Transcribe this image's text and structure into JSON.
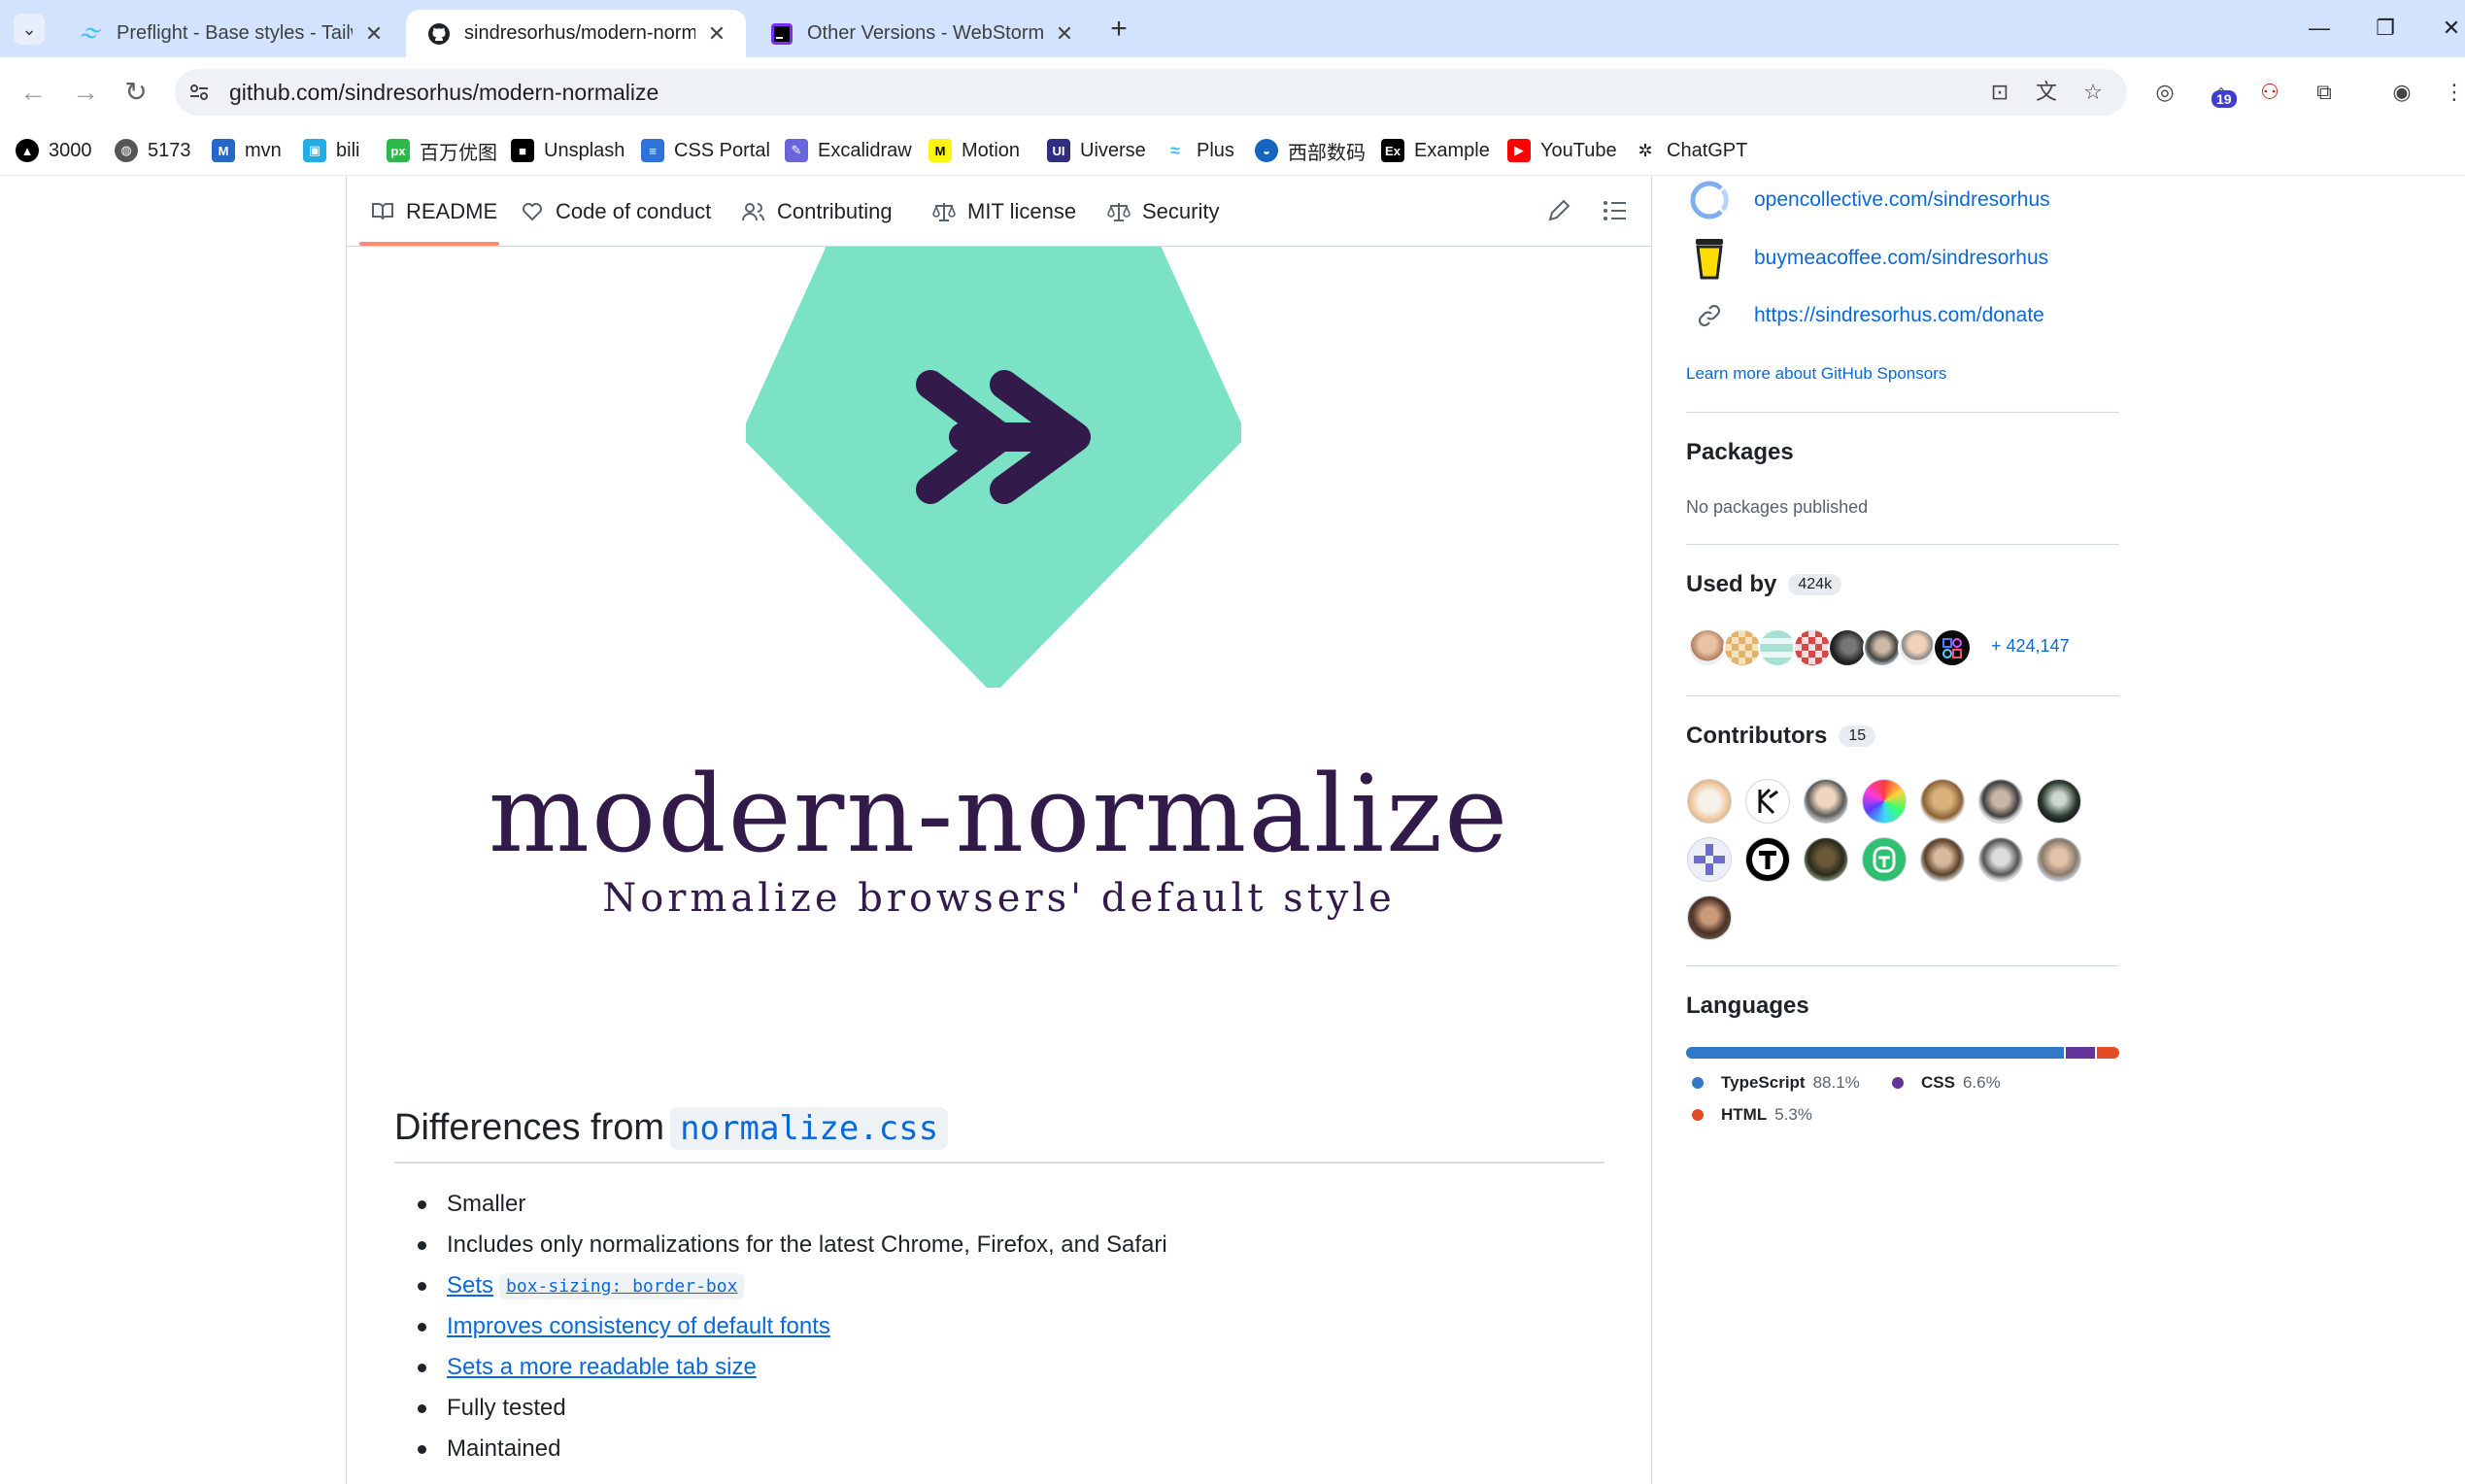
{
  "browser": {
    "tabs": [
      {
        "title": "Preflight - Base styles - Tailwi",
        "active": false
      },
      {
        "title": "sindresorhus/modern-norma",
        "active": true
      },
      {
        "title": "Other Versions - WebStorm",
        "active": false
      }
    ],
    "url": "github.com/sindresorhus/modern-normalize",
    "extension_badge": "19",
    "bookmarks": [
      "3000",
      "5173",
      "mvn",
      "bili",
      "百万优图",
      "Unsplash",
      "CSS Portal",
      "Excalidraw",
      "Motion",
      "Uiverse",
      "Plus",
      "西部数码",
      "Example",
      "YouTube",
      "ChatGPT"
    ]
  },
  "readme_tabs": [
    {
      "label": "README",
      "icon": "book-icon"
    },
    {
      "label": "Code of conduct",
      "icon": "heart-icon"
    },
    {
      "label": "Contributing",
      "icon": "people-icon"
    },
    {
      "label": "MIT license",
      "icon": "law-icon"
    },
    {
      "label": "Security",
      "icon": "law-icon"
    }
  ],
  "readme": {
    "logo_title": "modern-normalize",
    "logo_subtitle": "Normalize browsers' default style",
    "logo_colors": {
      "diamond": "#7be2c5",
      "arrow": "#321a4a"
    },
    "heading_text": "Differences from",
    "heading_code": "normalize.css",
    "list": [
      {
        "text": "Smaller",
        "link": false
      },
      {
        "text": "Includes only normalizations for the latest Chrome, Firefox, and Safari",
        "link": false
      },
      {
        "text": "Sets",
        "code": "box-sizing: border-box",
        "link": true
      },
      {
        "text": "Improves consistency of default fonts",
        "link": true
      },
      {
        "text": "Sets a more readable tab size",
        "link": true
      },
      {
        "text": "Fully tested",
        "link": false
      },
      {
        "text": "Maintained",
        "link": false
      }
    ]
  },
  "sidebar": {
    "sponsors": [
      {
        "prefix": "opencollective.com/",
        "handle": "sindresorhus"
      },
      {
        "prefix": "buymeacoffee.com/",
        "handle": "sindresorhus"
      },
      {
        "prefix": "https://sindresorhus.com/donate",
        "handle": ""
      }
    ],
    "learn_more": "Learn more about GitHub Sponsors",
    "packages_title": "Packages",
    "packages_text": "No packages published",
    "used_by_title": "Used by",
    "used_by_count": "424k",
    "used_by_more": "+ 424,147",
    "contributors_title": "Contributors",
    "contributors_count": "15",
    "languages_title": "Languages",
    "languages": [
      {
        "name": "TypeScript",
        "percent": "88.1%",
        "value": 88.1,
        "color": "#3178c6"
      },
      {
        "name": "CSS",
        "percent": "6.6%",
        "value": 6.6,
        "color": "#663399"
      },
      {
        "name": "HTML",
        "percent": "5.3%",
        "value": 5.3,
        "color": "#e34c26"
      }
    ]
  }
}
